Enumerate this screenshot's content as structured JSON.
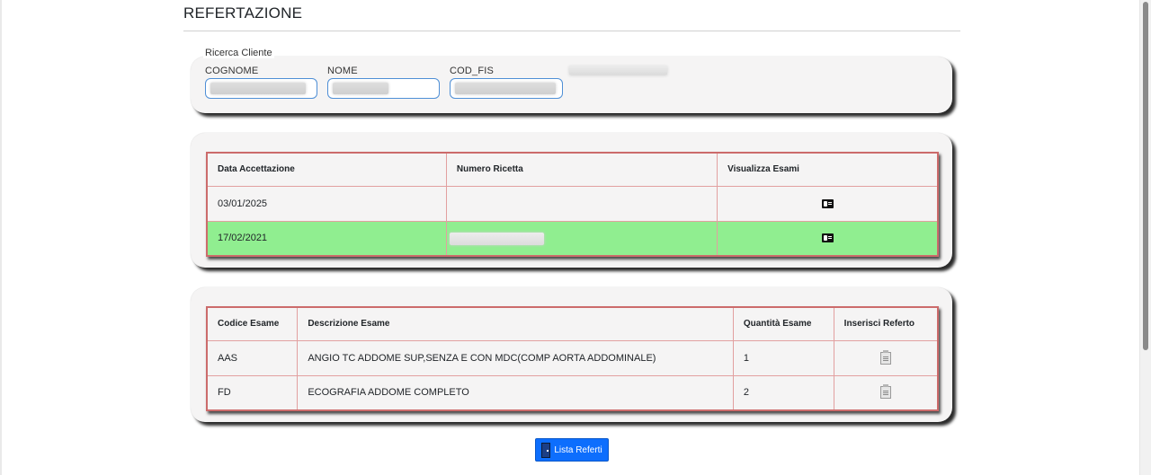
{
  "page": {
    "title": "REFERTAZIONE"
  },
  "search": {
    "legend": "Ricerca Cliente",
    "fields": [
      {
        "label": "COGNOME",
        "value": ""
      },
      {
        "label": "NOME",
        "value": ""
      },
      {
        "label": "COD_FIS",
        "value": ""
      }
    ]
  },
  "acceptance_table": {
    "headers": [
      "Data Accettazione",
      "Numero Ricetta",
      "Visualizza Esami"
    ],
    "rows": [
      {
        "date": "03/01/2025",
        "prescription": "",
        "icon": "id-card-icon",
        "selected": false
      },
      {
        "date": "17/02/2021",
        "prescription": "",
        "icon": "id-card-icon",
        "selected": true
      }
    ],
    "selected_color": "#90ee90"
  },
  "exams_table": {
    "headers": [
      "Codice Esame",
      "Descrizione Esame",
      "Quantità Esame",
      "Inserisci Referto"
    ],
    "rows": [
      {
        "code": "AAS",
        "description": "ANGIO TC ADDOME SUP,SENZA E CON MDC(COMP AORTA ADDOMINALE)",
        "quantity": "1",
        "icon": "report-icon"
      },
      {
        "code": "FD",
        "description": "ECOGRAFIA ADDOME COMPLETO",
        "quantity": "2",
        "icon": "report-icon"
      }
    ]
  },
  "actions": {
    "lista_referti_label": "Lista Referti",
    "lista_referti_icon": "door-icon"
  },
  "colors": {
    "primary": "#0d6efd",
    "table_border": "#e2a0a0",
    "card_bg": "#f5f4f4"
  }
}
